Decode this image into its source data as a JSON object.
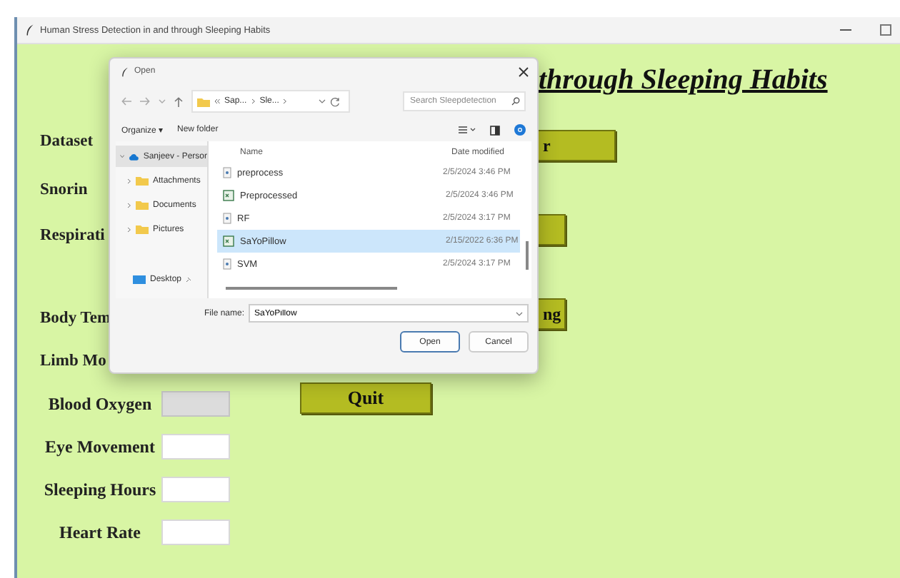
{
  "window": {
    "title": "Human Stress Detection in and through Sleeping Habits"
  },
  "heading": "through Sleeping Habits",
  "form_rows": [
    {
      "kind": "label",
      "label": "Dataset"
    },
    {
      "kind": "label",
      "label": "Snorin"
    },
    {
      "kind": "label",
      "label": "Respirati"
    },
    {
      "kind": "label",
      "label": "Body Tem"
    },
    {
      "kind": "label",
      "label": "Limb Mo"
    },
    {
      "kind": "field",
      "label": "Blood Oxygen",
      "disabled": true
    },
    {
      "kind": "field",
      "label": "Eye Movement",
      "disabled": false
    },
    {
      "kind": "field",
      "label": "Sleeping Hours",
      "disabled": false
    },
    {
      "kind": "field",
      "label": "Heart Rate",
      "disabled": false
    }
  ],
  "side_buttons": [
    "r",
    "ng"
  ],
  "quit_button": "Quit",
  "dialog": {
    "title": "Open",
    "breadcrumb": [
      "Sap...",
      "Sle..."
    ],
    "search": {
      "placeholder": "Search Sleepdetection"
    },
    "toolbar": [
      "Organize ▾",
      "New folder"
    ],
    "nav_items": [
      {
        "label": "Sanjeev - Persor",
        "kind": "cloud",
        "selected": true
      },
      {
        "label": "Attachments",
        "kind": "folder",
        "selected": false
      },
      {
        "label": "Documents",
        "kind": "folder",
        "selected": false
      },
      {
        "label": "Pictures",
        "kind": "folder",
        "selected": false
      },
      {
        "label": "Desktop",
        "kind": "desktop",
        "selected": false
      }
    ],
    "columns": [
      "Name",
      "Date modified"
    ],
    "files": [
      {
        "name": "preprocess",
        "date": "2/5/2024 3:46 PM",
        "kind": "file",
        "selected": false
      },
      {
        "name": "Preprocessed",
        "date": "2/5/2024 3:46 PM",
        "kind": "sheet",
        "selected": false
      },
      {
        "name": "RF",
        "date": "2/5/2024 3:17 PM",
        "kind": "file",
        "selected": false
      },
      {
        "name": "SaYoPillow",
        "date": "2/15/2022 6:36 PM",
        "kind": "sheet",
        "selected": true
      },
      {
        "name": "SVM",
        "date": "2/5/2024 3:17 PM",
        "kind": "file",
        "selected": false
      }
    ],
    "file_name_label": "File name:",
    "file_name": "SaYoPillow",
    "buttons": [
      "Open",
      "Cancel"
    ]
  }
}
